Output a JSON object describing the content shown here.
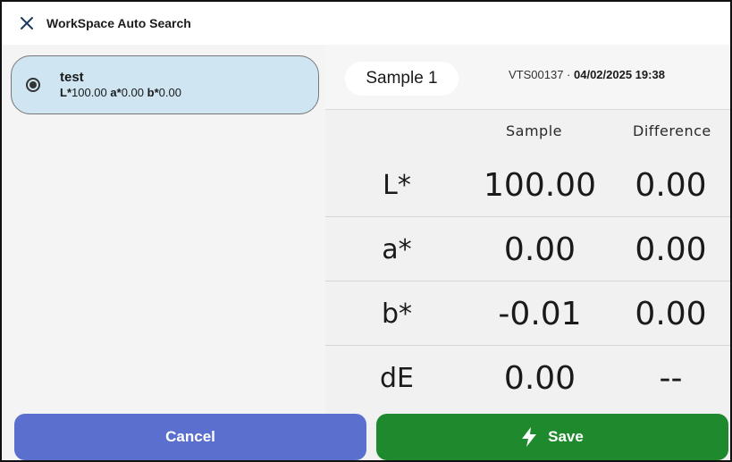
{
  "window": {
    "title": "WorkSpace Auto Search"
  },
  "icons": {
    "close": "close-icon",
    "radio": "radio-selected-icon",
    "save": "bolt-icon"
  },
  "colors": {
    "card_bg": "#cfe6f2",
    "cancel": "#5b6fce",
    "save": "#1e8a2d"
  },
  "sample_list": [
    {
      "name": "test",
      "selected": true,
      "L_label": "L*",
      "L_value": "100.00",
      "a_label": "a*",
      "a_value": "0.00",
      "b_label": "b*",
      "b_value": "0.00"
    }
  ],
  "detail": {
    "sample_name": "Sample 1",
    "device_id": "VTS00137",
    "separator": " · ",
    "datetime": "04/02/2025 19:38",
    "columns": [
      "Sample",
      "Difference"
    ],
    "rows": [
      {
        "label": "L*",
        "sample": "100.00",
        "difference": "0.00"
      },
      {
        "label": "a*",
        "sample": "0.00",
        "difference": "0.00"
      },
      {
        "label": "b*",
        "sample": "-0.01",
        "difference": "0.00"
      },
      {
        "label": "dE",
        "sample": "0.00",
        "difference": "--"
      }
    ]
  },
  "footer": {
    "cancel_label": "Cancel",
    "save_label": "Save"
  }
}
